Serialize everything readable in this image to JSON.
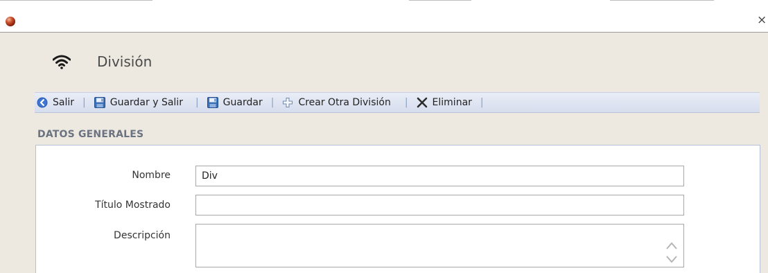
{
  "window": {
    "close_glyph": "×"
  },
  "header": {
    "title": "División",
    "icon": "wifi-icon"
  },
  "toolbar": {
    "salir": "Salir",
    "guardar_salir": "Guardar y Salir",
    "guardar": "Guardar",
    "crear": "Crear Otra División",
    "eliminar": "Eliminar",
    "separator": "|"
  },
  "section": {
    "title": "DATOS GENERALES"
  },
  "form": {
    "nombre_label": "Nombre",
    "nombre_value": "Div",
    "titulo_label": "Título Mostrado",
    "titulo_value": "",
    "descripcion_label": "Descripción",
    "descripcion_value": ""
  },
  "colors": {
    "dialog_bg": "#ede9e0",
    "toolbar_bg": "#dde3f1",
    "accent_blue": "#2f5fb3"
  }
}
